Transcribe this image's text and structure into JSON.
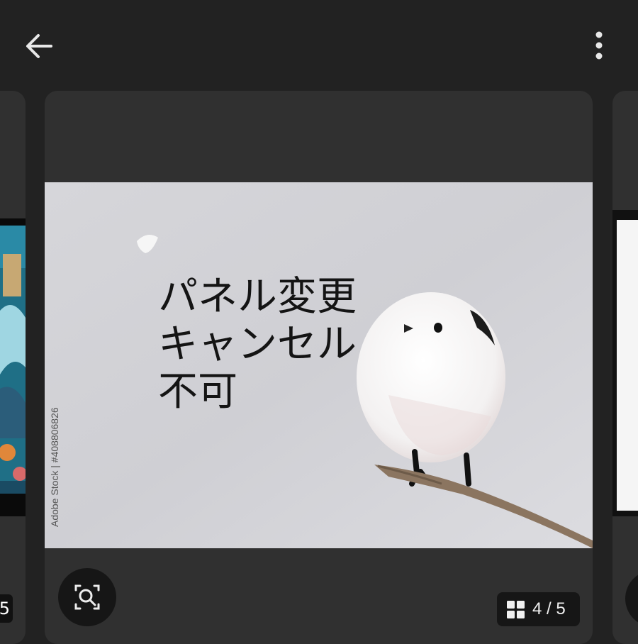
{
  "toolbar": {
    "back_icon": "arrow-left-icon",
    "more_icon": "more-vert-icon"
  },
  "viewer": {
    "overlay_lines": [
      "パネル変更",
      "キャンセル",
      "不可"
    ],
    "watermark": "Adobe Stock | #408806826",
    "lens_icon": "image-search-icon",
    "counter": "4 / 5",
    "counter_icon": "grid-icon",
    "prev_counter_fragment": "5"
  },
  "colors": {
    "background": "#222222",
    "card": "#303030",
    "button": "#161616",
    "text": "#f0f0f0"
  }
}
